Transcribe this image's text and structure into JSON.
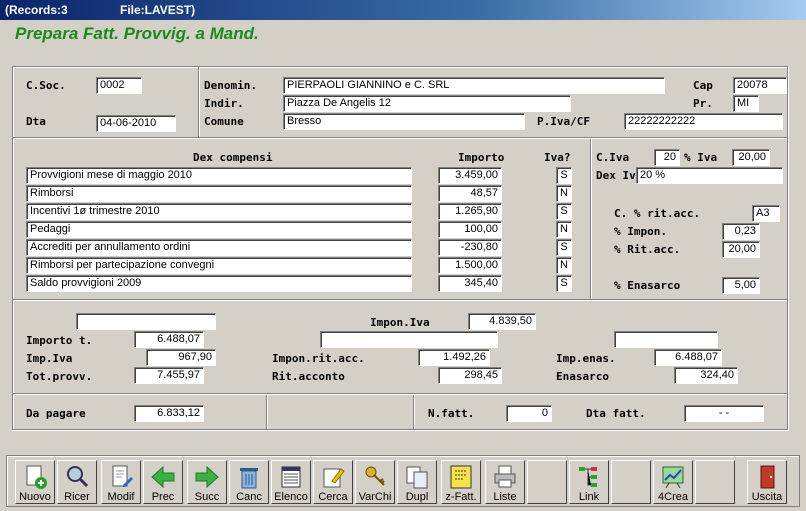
{
  "window": {
    "records": "(Records:3",
    "file": "File:LAVEST)"
  },
  "form_title": "Prepara Fatt. Provvig. a Mand.",
  "header": {
    "csoc_label": "C.Soc.",
    "csoc": "0002",
    "dta_label": "Dta",
    "dta": "04-06-2010",
    "denomin_label": "Denomin.",
    "denomin": "PIERPAOLI GIANNINO e C. SRL",
    "indir_label": "Indir.",
    "indir": "Piazza De Angelis 12",
    "comune_label": "Comune",
    "comune": "Bresso",
    "cap_label": "Cap",
    "cap": "20078",
    "pr_label": "Pr.",
    "pr": "MI",
    "piva_label": "P.Iva/CF",
    "piva": "22222222222"
  },
  "compensi": {
    "col_dex": "Dex compensi",
    "col_importo": "Importo",
    "col_iva": "Iva?",
    "rows": [
      {
        "dex": "Provvigioni mese di maggio 2010",
        "importo": "3.459,00",
        "iva": "S"
      },
      {
        "dex": "Rimborsi",
        "importo": "48,57",
        "iva": "N"
      },
      {
        "dex": "Incentivi 1ø trimestre 2010",
        "importo": "1.265,90",
        "iva": "S"
      },
      {
        "dex": "Pedaggi",
        "importo": "100,00",
        "iva": "N"
      },
      {
        "dex": "Accrediti per annullamento ordini",
        "importo": "-230,80",
        "iva": "S"
      },
      {
        "dex": "Rimborsi per partecipazione convegni",
        "importo": "1.500,00",
        "iva": "N"
      },
      {
        "dex": "Saldo provvigioni 2009",
        "importo": "345,40",
        "iva": "S"
      }
    ]
  },
  "iva": {
    "civa_label": "C.Iva",
    "civa": "20",
    "piva_label": "% Iva",
    "piva": "20,00",
    "dexiva_label": "Dex Iv",
    "dexiva": "20 %",
    "critacc_label": "C. % rit.acc.",
    "critacc": "A3",
    "impon_label": "% Impon.",
    "impon": "0,23",
    "ritacc_label": "% Rit.acc.",
    "ritacc": "20,00",
    "enasarco_label": "% Enasarco",
    "enasarco": "5,00"
  },
  "totals": {
    "blank1": "",
    "impon_iva_label": "Impon.Iva",
    "impon_iva": "4.839,50",
    "importo_t_label": "Importo t.",
    "importo_t": "6.488,07",
    "blank2": "",
    "blank3": "",
    "imp_iva_label": "Imp.Iva",
    "imp_iva": "967,90",
    "impon_ritacc_label": "Impon.rit.acc.",
    "impon_ritacc": "1.492,26",
    "imp_enas_label": "Imp.enas.",
    "imp_enas": "6.488,07",
    "tot_provv_label": "Tot.provv.",
    "tot_provv": "7.455,97",
    "rit_acconto_label": "Rit.acconto",
    "rit_acconto": "298,45",
    "enasarco_label": "Enasarco",
    "enasarco": "324,40"
  },
  "footer": {
    "da_pagare_label": "Da pagare",
    "da_pagare": "6.833,12",
    "nfatt_label": "N.fatt.",
    "nfatt": "0",
    "dtafatt_label": "Dta fatt.",
    "dtafatt": "-   -"
  },
  "toolbar": {
    "nuovo": "Nuovo",
    "ricer": "Ricer",
    "modif": "Modif",
    "prec": "Prec",
    "succ": "Succ",
    "canc": "Canc",
    "elenco": "Elenco",
    "cerca": "Cerca",
    "varchi": "VarChi",
    "dupl": "Dupl",
    "zfatt": "z-Fatt.",
    "liste": "Liste",
    "link": "Link",
    "crea": "4Crea",
    "uscita": "Uscita"
  }
}
